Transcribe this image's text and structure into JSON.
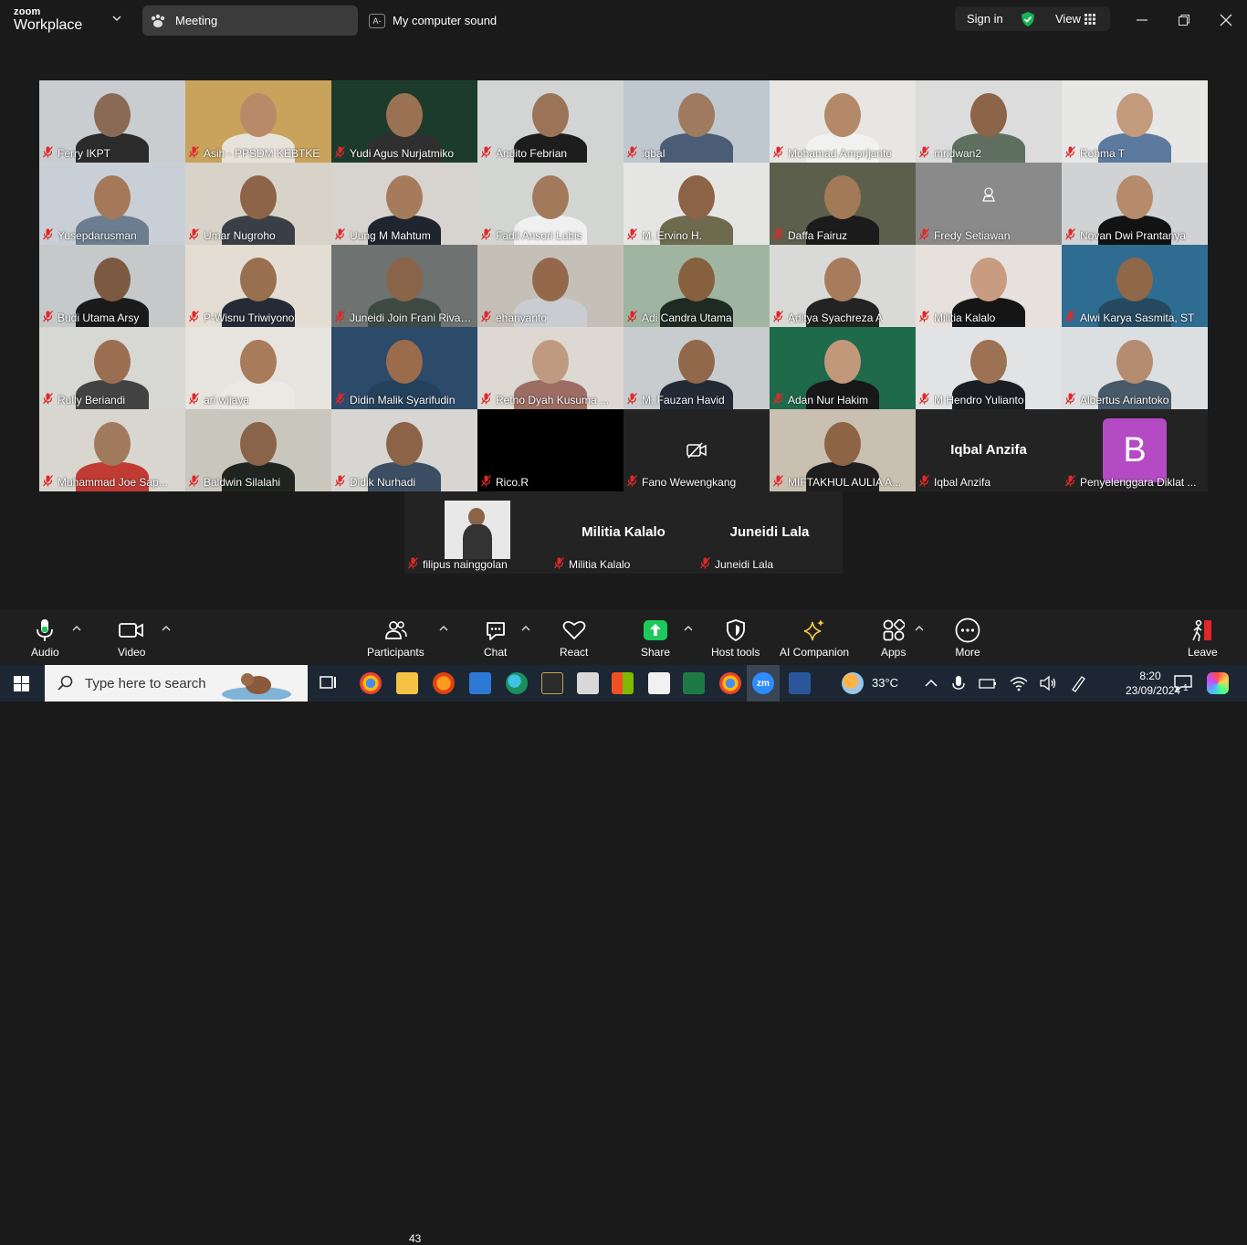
{
  "titlebar": {
    "logo_line1": "zoom",
    "logo_line2": "Workplace",
    "meeting_tab": "Meeting",
    "sound_badge": "A-",
    "sound_tab": "My computer sound",
    "signin": "Sign in",
    "view": "View"
  },
  "tiles": [
    {
      "name": "Ferry IKPT",
      "bg": "#c9cdd0",
      "skin": "#8a6a55",
      "shirt": "#2b2b2b"
    },
    {
      "name": "Asih - PPSDM KEBTKE",
      "bg": "#c9a25c",
      "skin": "#b98a6a",
      "shirt": "#e8e3da",
      "active": true
    },
    {
      "name": "Yudi Agus Nurjatmiko",
      "bg": "#1d3b2c",
      "skin": "#9a7253",
      "shirt": "#2f2f2f"
    },
    {
      "name": "Andito Febrian",
      "bg": "#d2d5d3",
      "skin": "#9b7458",
      "shirt": "#1d1d1d"
    },
    {
      "name": "iqbal",
      "bg": "#bfc7cf",
      "skin": "#a07a5e",
      "shirt": "#4b5d74"
    },
    {
      "name": "Mohamad.Amprijanto",
      "bg": "#e8e6e2",
      "skin": "#b4896a",
      "shirt": "#f1f1ef"
    },
    {
      "name": "mridwan2",
      "bg": "#dcdcdc",
      "skin": "#8c6448",
      "shirt": "#5e6f60"
    },
    {
      "name": "Rohma T",
      "bg": "#e7e7e5",
      "skin": "#c29a7c",
      "shirt": "#5b7a9e"
    },
    {
      "name": "Yusepdarusman",
      "bg": "#c8cfd6",
      "skin": "#a5785a",
      "shirt": "#6b7d8f"
    },
    {
      "name": "Umar Nugroho",
      "bg": "#d8d3c9",
      "skin": "#8d6448",
      "shirt": "#3a3f47"
    },
    {
      "name": "Uung M Mahtum",
      "bg": "#d7d3ce",
      "skin": "#a57b5b",
      "shirt": "#1f2530"
    },
    {
      "name": "Fadil Ansori Lubis",
      "bg": "#d3d5d2",
      "skin": "#a27a5b",
      "shirt": "#f0f0f0"
    },
    {
      "name": "M. Ervino H.",
      "bg": "#e5e5e3",
      "skin": "#8c6346",
      "shirt": "#6d6a4e"
    },
    {
      "name": "Daffa Fairuz",
      "bg": "#5d5f4d",
      "skin": "#a27a58",
      "shirt": "#1b1b1b"
    },
    {
      "name": "Fredy Setiawan",
      "bg": "#8a8a8a",
      "placeholder": true
    },
    {
      "name": "Novan Dwi Prantanya",
      "bg": "#d0d2d3",
      "skin": "#b58b6c",
      "shirt": "#121212"
    },
    {
      "name": "Budi Utama Arsy",
      "bg": "#c6c9ca",
      "skin": "#7c5a41",
      "shirt": "#1a1a1a"
    },
    {
      "name": "P-Wisnu Triwiyono",
      "bg": "#e3ddd3",
      "skin": "#98704f",
      "shirt": "#242a36"
    },
    {
      "name": "Juneidi Join Frani Rival L...",
      "bg": "#6e7270",
      "skin": "#8a6448",
      "shirt": "#3d4a44"
    },
    {
      "name": "ehariyanto",
      "bg": "#c4c0b8",
      "skin": "#94694b",
      "shirt": "#c9cdd1"
    },
    {
      "name": "Adi Candra Utama",
      "bg": "#9fb5a1",
      "skin": "#86603f",
      "shirt": "#1d2b22"
    },
    {
      "name": "Aditya Syachreza A",
      "bg": "#d9dad7",
      "skin": "#a77c5d",
      "shirt": "#232323"
    },
    {
      "name": "Militia Kalalo",
      "bg": "#e6e1dc",
      "skin": "#c79c80",
      "shirt": "#151515"
    },
    {
      "name": "Alwi Karya Sasmita, ST",
      "bg": "#2f6c92",
      "skin": "#8f6749",
      "shirt": "#254a60"
    },
    {
      "name": "Rully Beriandi",
      "bg": "#d7d7d4",
      "skin": "#9a6f51",
      "shirt": "#434343"
    },
    {
      "name": "ari wijaya",
      "bg": "#e7e3df",
      "skin": "#a87c5b",
      "shirt": "#ece9e4"
    },
    {
      "name": "Didin Malik Syarifudin",
      "bg": "#2c4a6a",
      "skin": "#9a6c4c",
      "shirt": "#23405c"
    },
    {
      "name": "Retno Dyah Kusuma ...",
      "bg": "#ddd8d2",
      "skin": "#c09a80",
      "shirt": "#9d6c62"
    },
    {
      "name": "M. Fauzan Havid",
      "bg": "#c9ccce",
      "skin": "#91684a",
      "shirt": "#222a36"
    },
    {
      "name": "Adan Nur Hakim",
      "bg": "#1e6a4b",
      "skin": "#c2987a",
      "shirt": "#181818"
    },
    {
      "name": "M Hendro Yulianto",
      "bg": "#e1e3e4",
      "skin": "#9c7154",
      "shirt": "#1a1d22"
    },
    {
      "name": "Albertus Ariantoko",
      "bg": "#dcdfe1",
      "skin": "#b48d70",
      "shirt": "#485969"
    },
    {
      "name": "Muhammad Joe Sap...",
      "bg": "#d9d6d0",
      "skin": "#a17a5e",
      "shirt": "#c03b33"
    },
    {
      "name": "Baldwin Silalahi",
      "bg": "#c9c6be",
      "skin": "#8a6448",
      "shirt": "#1f2420"
    },
    {
      "name": "Didik Nurhadi",
      "bg": "#d7d6d3",
      "skin": "#8c6347",
      "shirt": "#3c4e64"
    },
    {
      "name": "Rico.R",
      "bg": "#000000",
      "blank": true
    },
    {
      "name": "Fano Wewengkang",
      "bg": "#232323",
      "videooff": true
    },
    {
      "name": "MIFTAKHUL AULIA A...",
      "bg": "#c9c0b2",
      "skin": "#8d6446",
      "shirt": "#1e1e1e"
    },
    {
      "name": "Iqbal Anzifa",
      "bg": "#232323",
      "centername": "Iqbal Anzifa"
    },
    {
      "name": "Penyelenggara Diklat ...",
      "bg": "#232323",
      "avatar": "B",
      "avatar_color": "#b44ac4"
    }
  ],
  "bottom_tiles": [
    {
      "name": "filipus nainggolan",
      "bg": "#232323",
      "photo": true
    },
    {
      "name": "Militia Kalalo",
      "centername": "Militia Kalalo"
    },
    {
      "name": "Juneidi Lala",
      "centername": "Juneidi Lala"
    }
  ],
  "toolbar": {
    "audio": "Audio",
    "video": "Video",
    "participants": "Participants",
    "participants_count": "43",
    "chat": "Chat",
    "react": "React",
    "share": "Share",
    "host_tools": "Host tools",
    "ai_companion": "AI Companion",
    "apps": "Apps",
    "more": "More",
    "leave": "Leave"
  },
  "taskbar": {
    "search_placeholder": "Type here to search",
    "temperature": "33°C",
    "time": "8:20",
    "date": "23/09/2024",
    "notification_count": "1"
  },
  "colors": {
    "active_speaker": "#2ee36e",
    "share_green": "#1ec95b",
    "leave_red": "#e02828",
    "shield_green": "#16b35a"
  }
}
